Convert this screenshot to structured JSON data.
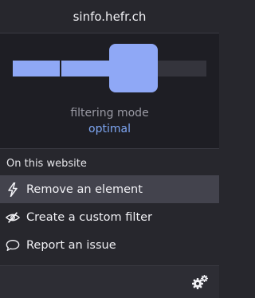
{
  "header": {
    "hostname": "sinfo.hefr.ch"
  },
  "filtering": {
    "mode_label": "filtering mode",
    "mode_value": "optimal",
    "level": 3,
    "level_max": 4,
    "accent_color": "#8fa8f6"
  },
  "section": {
    "title": "On this website"
  },
  "actions": [
    {
      "label": "Remove an element",
      "icon": "lightning-icon"
    },
    {
      "label": "Create a custom filter",
      "icon": "eye-slash-icon"
    },
    {
      "label": "Report an issue",
      "icon": "comment-icon"
    }
  ],
  "footer": {
    "settings_icon": "gears-icon"
  }
}
